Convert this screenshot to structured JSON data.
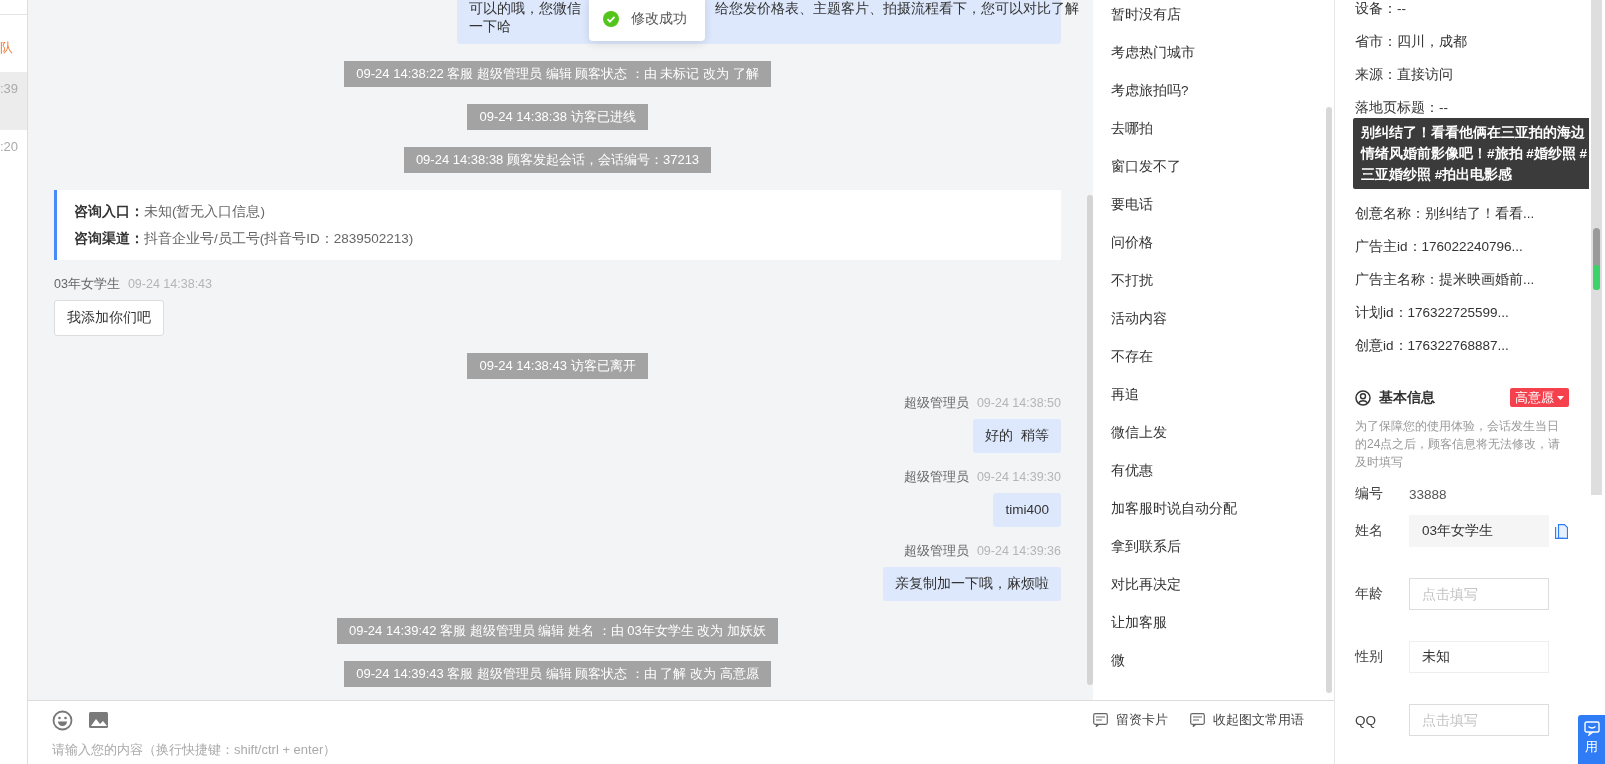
{
  "left_list": {
    "items": [
      {
        "text": "队",
        "kind": "tag",
        "selected": false
      },
      {
        "text": ":39",
        "kind": "time",
        "selected": true
      },
      {
        "text": ":20",
        "kind": "time",
        "selected": false
      }
    ]
  },
  "toast": {
    "kind": "success",
    "text": "修改成功"
  },
  "chat": {
    "messages": [
      {
        "kind": "agent_continued",
        "lines": [
          [
            "可以的哦，您微信",
            "给您发价格表、主题客片、拍摄流程看下，您可以对比了解"
          ],
          [
            "一下哈"
          ]
        ]
      },
      {
        "kind": "system",
        "text": "09-24 14:38:22 客服 超级管理员 编辑 顾客状态 ：由 未标记 改为 了解"
      },
      {
        "kind": "system",
        "text": "09-24 14:38:38 访客已进线"
      },
      {
        "kind": "system",
        "text": "09-24 14:38:38 顾客发起会话，会话编号：37213"
      },
      {
        "kind": "info_card",
        "rows": [
          {
            "label": "咨询入口：",
            "value": "未知(暂无入口信息)"
          },
          {
            "label": "咨询渠道：",
            "value": "抖音企业号/员工号(抖音号ID：2839502213)"
          }
        ]
      },
      {
        "kind": "customer",
        "sender": "03年女学生",
        "time": "09-24 14:38:43",
        "text": "我添加你们吧"
      },
      {
        "kind": "system",
        "text": "09-24 14:38:43 访客已离开"
      },
      {
        "kind": "agent",
        "sender": "超级管理员",
        "time": "09-24 14:38:50",
        "text": "好的  稍等"
      },
      {
        "kind": "agent",
        "sender": "超级管理员",
        "time": "09-24 14:39:30",
        "text": "timi400"
      },
      {
        "kind": "agent",
        "sender": "超级管理员",
        "time": "09-24 14:39:36",
        "text": "亲复制加一下哦，麻烦啦"
      },
      {
        "kind": "system",
        "text": "09-24 14:39:42 客服 超级管理员 编辑 姓名 ：由 03年女学生 改为 加妖妖"
      },
      {
        "kind": "system",
        "text": "09-24 14:39:43 客服 超级管理员 编辑 顾客状态 ：由 了解 改为 高意愿"
      }
    ]
  },
  "quick_replies": {
    "items": [
      "暂时没有店",
      "考虑热门城市",
      "考虑旅拍吗?",
      "去哪拍",
      "窗口发不了",
      "要电话",
      "问价格",
      "不打扰",
      "活动内容",
      "不存在",
      "再追",
      "微信上发",
      "有优惠",
      "加客服时说自动分配",
      "拿到联系后",
      "对比再决定",
      "让加客服",
      "微"
    ]
  },
  "composer": {
    "placeholder": "请输入您的内容（换行快捷键：shift/ctrl + enter）",
    "actions": [
      "留资卡片",
      "收起图文常用语"
    ]
  },
  "customer": {
    "details": [
      "设备：--",
      "省市：四川，成都",
      "来源：直接访问",
      "落地页标题：--",
      "创意名称：别纠结了！看看...",
      "广告主id：176022240796...",
      "广告主名称：提米映画婚前...",
      "计划id：176322725599...",
      "创意id：176322768887..."
    ],
    "tooltip": "别纠结了！看看他俩在三亚拍的海边情绪风婚前影像吧！#旅拍 #婚纱照 #三亚婚纱照 #拍出电影感",
    "basic": {
      "title": "基本信息",
      "badge": {
        "text": "高意愿",
        "color": "#f5414d"
      },
      "note": "为了保障您的使用体验，会话发生当日的24点之后，顾客信息将无法修改，请及时填写",
      "fields": [
        {
          "label": "编号",
          "kind": "text",
          "value": "33888"
        },
        {
          "label": "姓名",
          "kind": "readonly",
          "value": "03年女学生",
          "copy": true
        },
        {
          "label": "年龄",
          "kind": "input",
          "placeholder": "点击填写"
        },
        {
          "label": "性别",
          "kind": "select",
          "value": "未知"
        },
        {
          "label": "QQ",
          "kind": "input",
          "placeholder": "点击填写"
        }
      ]
    }
  },
  "float_button": {
    "text": "用"
  }
}
